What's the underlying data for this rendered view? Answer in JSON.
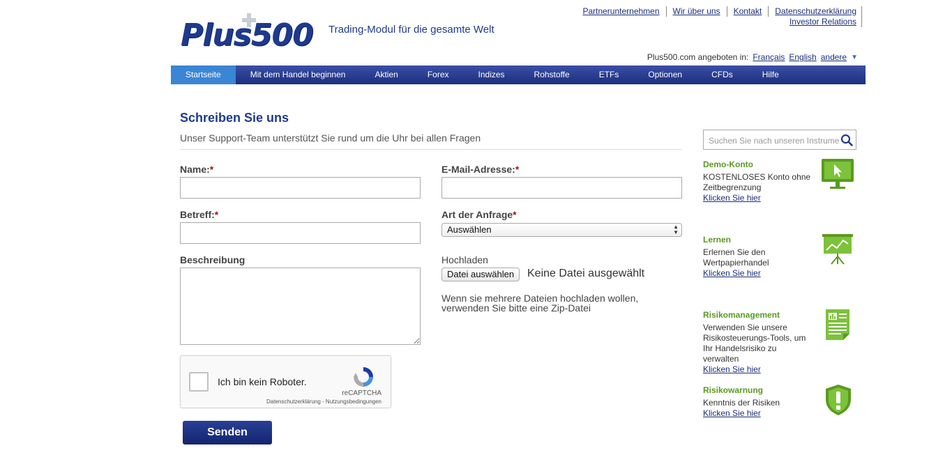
{
  "header": {
    "toplinks": [
      "Partnerunternehmen",
      "Wir über uns",
      "Kontakt",
      "Datenschutzerklärung"
    ],
    "investor_relations": "Investor Relations",
    "logo_text": "Plus500",
    "tagline": "Trading-Modul für die gesamte Welt",
    "lang_prefix": "Plus500.com angeboten in:",
    "lang_options": [
      "Français",
      "English",
      "andere"
    ]
  },
  "nav": {
    "items": [
      "Startseite",
      "Mit dem Handel beginnen",
      "Aktien",
      "Forex",
      "Indizes",
      "Rohstoffe",
      "ETFs",
      "Optionen",
      "CFDs",
      "Hilfe"
    ],
    "active": "Startseite"
  },
  "form": {
    "title": "Schreiben Sie uns",
    "subtitle": "Unser Support-Team unterstützt Sie rund um die Uhr bei allen Fragen",
    "name_label": "Name:",
    "email_label": "E-Mail-Adresse:",
    "subject_label": "Betreff:",
    "type_label": "Art der Anfrage",
    "type_selected": "Auswählen",
    "description_label": "Beschreibung",
    "upload_label": "Hochladen",
    "file_button": "Datei auswählen",
    "file_status": "Keine Datei ausgewählt",
    "upload_hint": "Wenn sie mehrere Dateien hochladen wollen, verwenden Sie bitte eine Zip-Datei",
    "required_mark": "*",
    "captcha_text": "Ich bin kein Roboter.",
    "captcha_brand": "reCAPTCHA",
    "captcha_terms": "Datenschutzerklärung - Nutzungsbedingungen",
    "submit": "Senden"
  },
  "sidebar": {
    "search_placeholder": "Suchen Sie nach unseren Instrumenten",
    "blocks": [
      {
        "title": "Demo-Konto",
        "text": "KOSTENLOSES Konto ohne Zeitbegrenzung",
        "link": "Klicken Sie hier",
        "icon": "monitor-cursor-icon"
      },
      {
        "title": "Lernen",
        "text": "Erlernen Sie den Wertpapierhandel",
        "link": "Klicken Sie hier",
        "icon": "presentation-board-icon"
      },
      {
        "title": "Risikomanagement",
        "text": "Verwenden Sie unsere Risikosteuerungs-Tools, um Ihr Handelsrisiko zu verwalten",
        "link": "Klicken Sie hier",
        "icon": "document-chart-icon"
      },
      {
        "title": "Risikowarnung",
        "text": "Kenntnis der Risiken",
        "link": "Klicken Sie hier",
        "icon": "shield-warning-icon"
      }
    ],
    "accent": "#5a9a1f"
  },
  "colors": {
    "brand": "#1e3a8e",
    "nav_active": "#3a86d4",
    "required": "#a31515"
  }
}
